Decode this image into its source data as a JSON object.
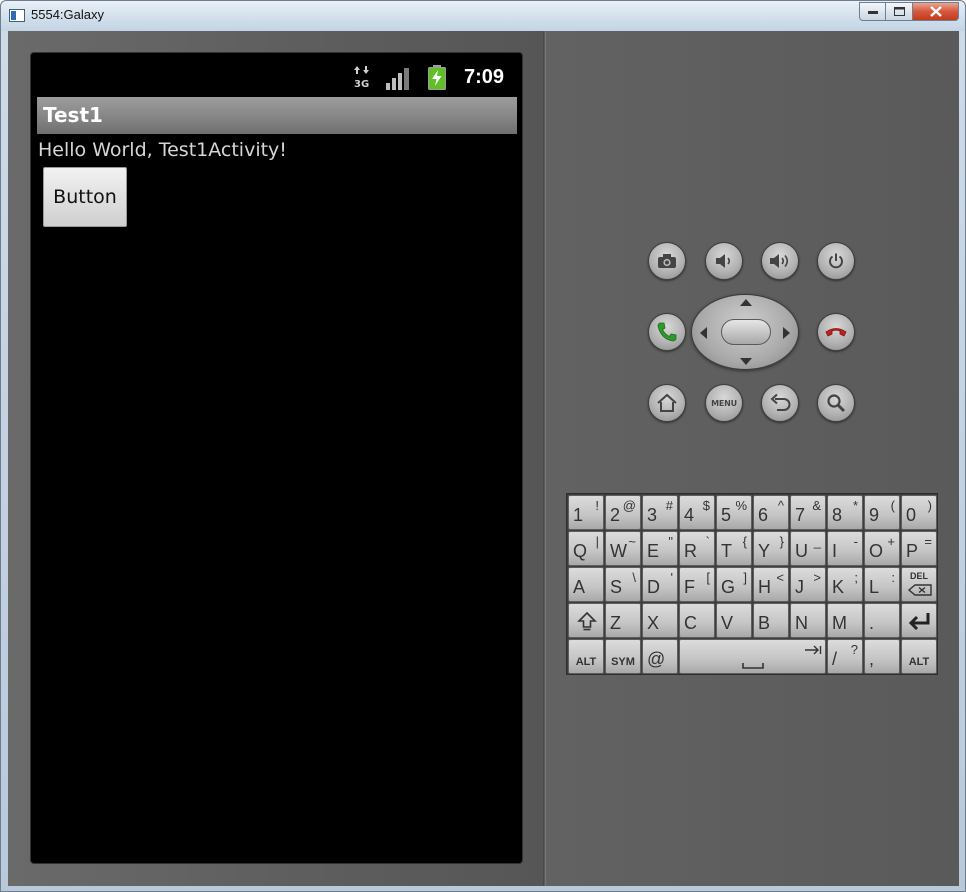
{
  "window": {
    "title": "5554:Galaxy"
  },
  "status_bar": {
    "time": "7:09",
    "network_icon": "3g-data-icon",
    "signal_icon": "signal-strength-icon",
    "battery_icon": "battery-charging-icon"
  },
  "app": {
    "title": "Test1",
    "hello_text": "Hello World, Test1Activity!",
    "button_label": "Button"
  },
  "controls": {
    "menu_label": "MENU"
  },
  "keyboard": {
    "row1": [
      {
        "main": "1",
        "alt": "!"
      },
      {
        "main": "2",
        "alt": "@"
      },
      {
        "main": "3",
        "alt": "#"
      },
      {
        "main": "4",
        "alt": "$"
      },
      {
        "main": "5",
        "alt": "%"
      },
      {
        "main": "6",
        "alt": "^"
      },
      {
        "main": "7",
        "alt": "&"
      },
      {
        "main": "8",
        "alt": "*"
      },
      {
        "main": "9",
        "alt": "("
      },
      {
        "main": "0",
        "alt": ")"
      }
    ],
    "row2": [
      {
        "main": "Q",
        "alt": "|"
      },
      {
        "main": "W",
        "alt": "~"
      },
      {
        "main": "E",
        "alt": "\""
      },
      {
        "main": "R",
        "alt": "`"
      },
      {
        "main": "T",
        "alt": "{"
      },
      {
        "main": "Y",
        "alt": "}"
      },
      {
        "main": "U",
        "alt": "_"
      },
      {
        "main": "I",
        "alt": "-"
      },
      {
        "main": "O",
        "alt": "+"
      },
      {
        "main": "P",
        "alt": "="
      }
    ],
    "row3": [
      {
        "main": "A",
        "alt": ""
      },
      {
        "main": "S",
        "alt": "\\"
      },
      {
        "main": "D",
        "alt": "'"
      },
      {
        "main": "F",
        "alt": "["
      },
      {
        "main": "G",
        "alt": "]"
      },
      {
        "main": "H",
        "alt": "<"
      },
      {
        "main": "J",
        "alt": ">"
      },
      {
        "main": "K",
        "alt": ";"
      },
      {
        "main": "L",
        "alt": ":"
      }
    ],
    "del_label": "DEL",
    "row4": [
      {
        "main": "Z"
      },
      {
        "main": "X"
      },
      {
        "main": "C"
      },
      {
        "main": "V"
      },
      {
        "main": "B"
      },
      {
        "main": "N"
      },
      {
        "main": "M"
      },
      {
        "main": "."
      }
    ],
    "alt_label": "ALT",
    "sym_label": "SYM",
    "at_label": "@",
    "slash_key": {
      "main": "/",
      "alt": "?"
    },
    "comma_key": {
      "main": ",",
      "alt": ""
    }
  }
}
